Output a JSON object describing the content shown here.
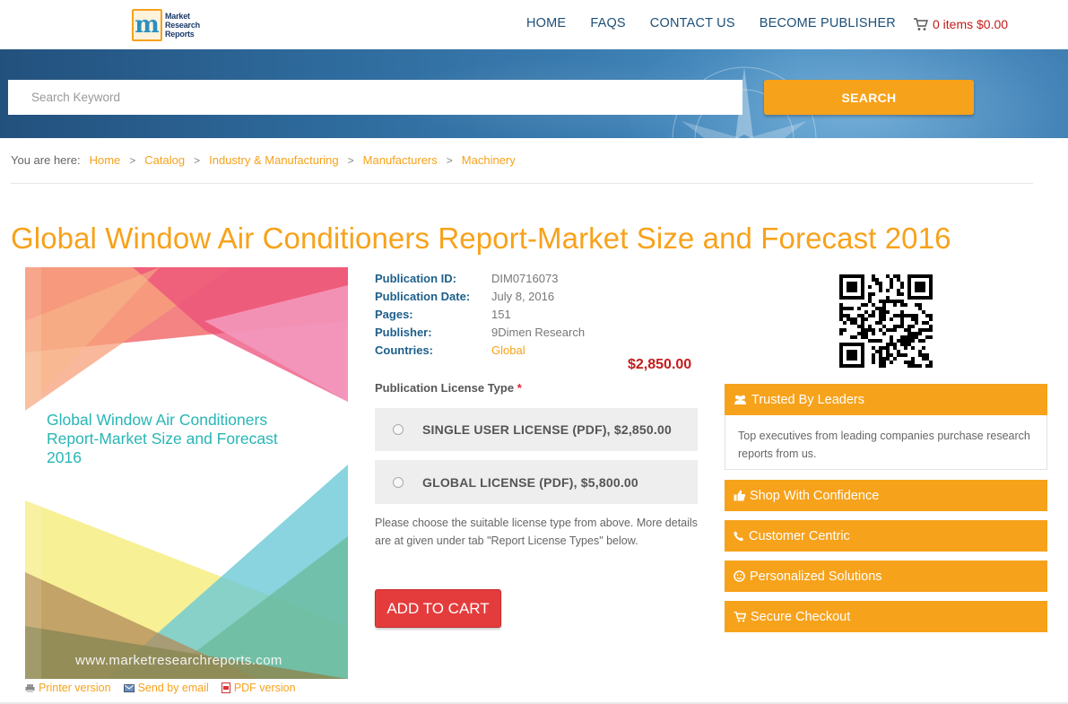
{
  "brand": {
    "logo_letter": "m",
    "logo_line1": "Market",
    "logo_line2": "Research",
    "logo_line3": "Reports"
  },
  "nav": {
    "home": "HOME",
    "faqs": "FAQS",
    "contact": "CONTACT US",
    "publisher": "BECOME PUBLISHER"
  },
  "cart": {
    "label": "0 items $0.00"
  },
  "search": {
    "placeholder": "Search Keyword",
    "button": "SEARCH"
  },
  "breadcrumb": {
    "lead": "You are here:",
    "items": [
      "Home",
      "Catalog",
      "Industry & Manufacturing",
      "Manufacturers",
      "Machinery"
    ],
    "separator": ">"
  },
  "title": "Global Window Air Conditioners Report-Market Size and Forecast 2016",
  "cover": {
    "title": "Global Window Air Conditioners Report-Market Size and Forecast 2016",
    "url": "www.marketresearchreports.com"
  },
  "utils": {
    "printer": "Printer version",
    "email": "Send by email",
    "pdf": "PDF version"
  },
  "details": {
    "publication_id_label": "Publication ID:",
    "publication_id": "DIM0716073",
    "publication_date_label": "Publication Date:",
    "publication_date": "July 8, 2016",
    "pages_label": "Pages:",
    "pages": "151",
    "publisher_label": "Publisher:",
    "publisher": "9Dimen Research",
    "countries_label": "Countries:",
    "countries": "Global"
  },
  "price": "$2,850.00",
  "license": {
    "label": "Publication License Type",
    "required_mark": "*",
    "options": [
      "SINGLE USER LICENSE (PDF), $2,850.00",
      "GLOBAL LICENSE (PDF), $5,800.00"
    ],
    "note": "Please choose the suitable license type from above. More details are at given under tab \"Report License Types\" below."
  },
  "add_to_cart": "ADD TO CART",
  "side": {
    "trusted_title": "Trusted By Leaders",
    "trusted_body": "Top executives from leading companies purchase research reports from us.",
    "shop": "Shop With Confidence",
    "customer": "Customer Centric",
    "personalized": "Personalized Solutions",
    "secure": "Secure Checkout"
  },
  "colors": {
    "accent": "#f7a21b",
    "price": "#c41b1b",
    "label_blue": "#1d5f8a",
    "cart_button": "#e43c3c",
    "banner": "#2e6a9c"
  }
}
